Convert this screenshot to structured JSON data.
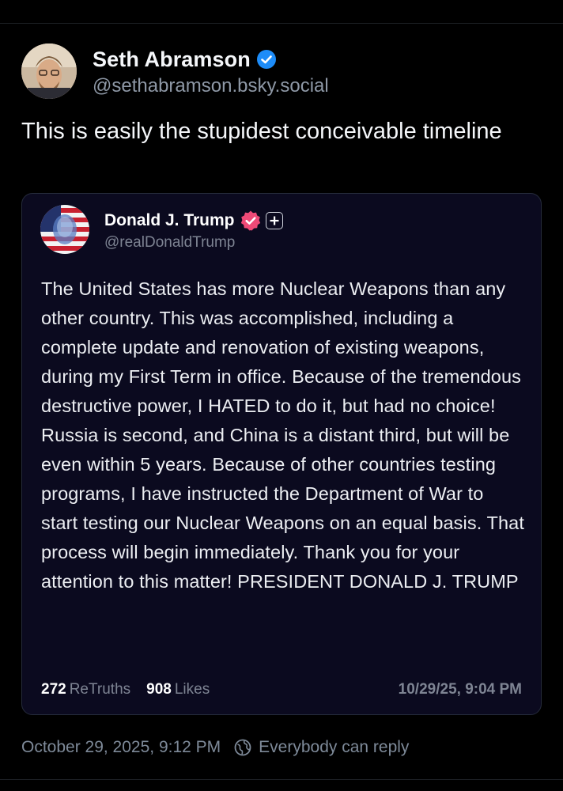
{
  "post": {
    "author_name": "Seth Abramson",
    "author_handle": "@sethabramson.bsky.social",
    "text": "This is easily the stupidest conceivable timeline",
    "date": "October 29, 2025, 9:12 PM",
    "reply_setting": "Everybody can reply"
  },
  "quote": {
    "author_name": "Donald J. Trump",
    "author_handle": "@realDonaldTrump",
    "text": "The United States has more Nuclear Weapons than any other country. This was accomplished, including a complete update and renovation of existing weapons, during my First Term in office. Because of the tremendous destructive power, I HATED to do it, but had no choice! Russia is second, and China is a distant third, but will be even within 5 years. Because of other countries testing programs, I have instructed the Department of War to start testing our Nuclear Weapons on an equal basis. That process will begin immediately. Thank you for your attention to this matter! PRESIDENT DONALD J. TRUMP",
    "retruths_count": "272",
    "retruths_label": "ReTruths",
    "likes_count": "908",
    "likes_label": "Likes",
    "timestamp": "10/29/25, 9:04 PM"
  },
  "colors": {
    "background": "#000000",
    "card_background": "#0b0a1f",
    "verified_blue": "#1d8cf8",
    "verified_pink": "#ef4a77",
    "muted_text": "#7e8a99"
  },
  "icons": {
    "author_badge": "verified-check-icon",
    "quote_badge": "verified-rosette-icon",
    "quote_extra_badge": "plus-icon",
    "reply_setting": "globe-icon"
  }
}
